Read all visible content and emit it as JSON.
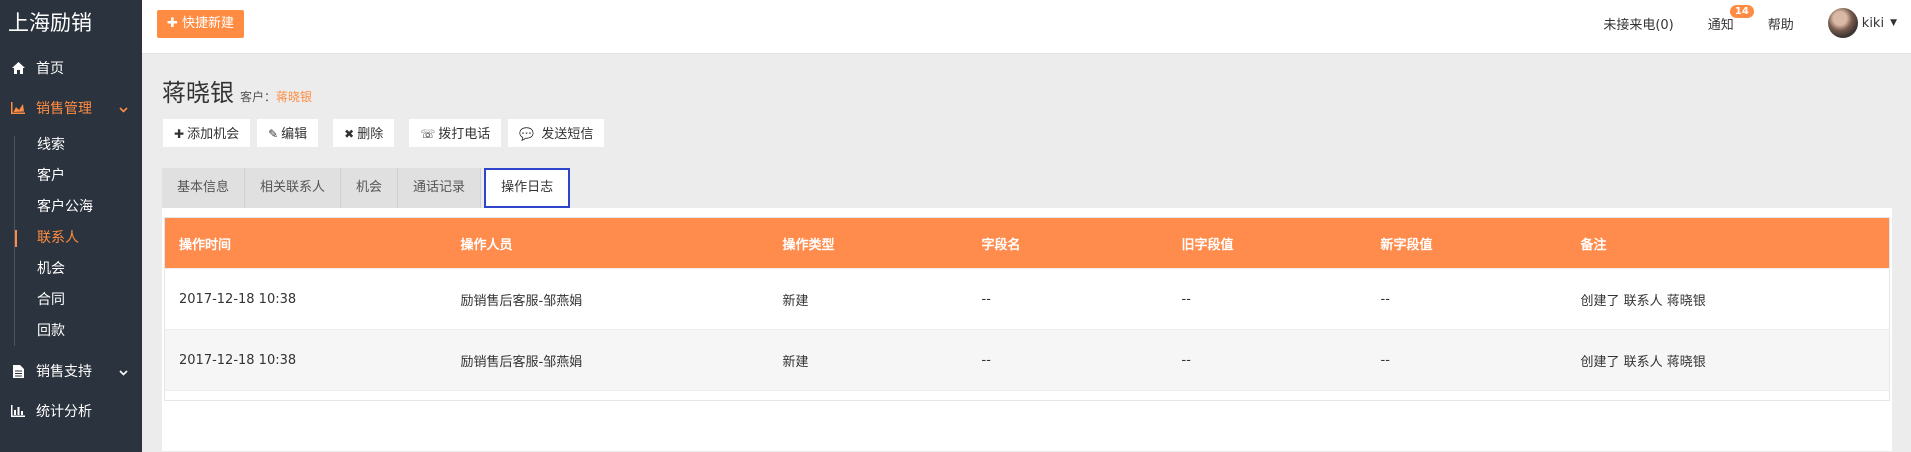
{
  "brand": "上海励销",
  "sidebar": {
    "items": [
      {
        "label": "首页",
        "icon": "home-icon"
      },
      {
        "label": "销售管理",
        "icon": "chart-area-icon"
      },
      {
        "label": "销售支持",
        "icon": "file-icon"
      },
      {
        "label": "统计分析",
        "icon": "bar-chart-icon"
      }
    ],
    "subitems": [
      "线索",
      "客户",
      "客户公海",
      "联系人",
      "机会",
      "合同",
      "回款"
    ],
    "active_sub": "联系人"
  },
  "topbar": {
    "quick_create": "快捷新建",
    "missed_calls": "未接来电(0)",
    "notifications": "通知",
    "notification_count": "14",
    "help": "帮助",
    "user_name": "kiki"
  },
  "page": {
    "title": "蒋晓银",
    "customer_label": "客户：",
    "customer_name": "蒋晓银"
  },
  "actions": {
    "add_opportunity": "添加机会",
    "edit": "编辑",
    "delete": "删除",
    "call": "拨打电话",
    "sms": "发送短信"
  },
  "tabs": [
    "基本信息",
    "相关联系人",
    "机会",
    "通话记录",
    "操作日志"
  ],
  "active_tab": "操作日志",
  "log_table": {
    "headers": [
      "操作时间",
      "操作人员",
      "操作类型",
      "字段名",
      "旧字段值",
      "新字段值",
      "备注"
    ],
    "rows": [
      [
        "2017-12-18 10:38",
        "励销售后客服-邹燕娟",
        "新建",
        "--",
        "--",
        "--",
        "创建了 联系人 蒋晓银"
      ],
      [
        "2017-12-18 10:38",
        "励销售后客服-邹燕娟",
        "新建",
        "--",
        "--",
        "--",
        "创建了 联系人 蒋晓银"
      ]
    ]
  },
  "colors": {
    "accent": "#ff8c42",
    "sidebar_bg": "#2b333e",
    "active_tab_border": "#2e45c9"
  }
}
